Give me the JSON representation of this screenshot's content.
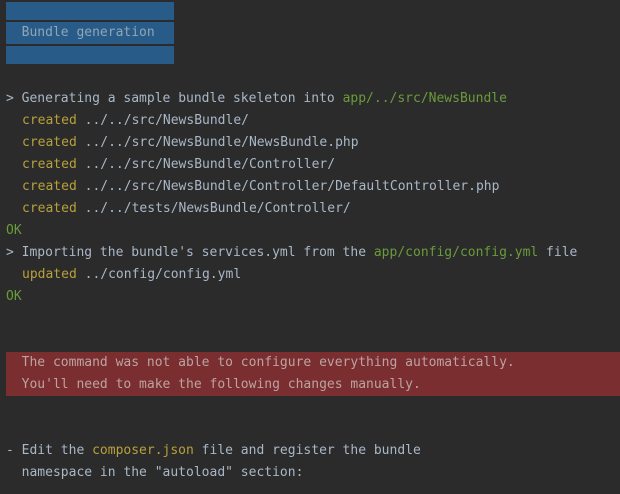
{
  "banner": {
    "title": "  Bundle generation"
  },
  "generate": {
    "prompt": "> ",
    "text": "Generating a sample bundle skeleton into ",
    "path": "app/../src/NewsBundle",
    "created": [
      {
        "label": "created",
        "path": " ../../src/NewsBundle/"
      },
      {
        "label": "created",
        "path": " ../../src/NewsBundle/NewsBundle.php"
      },
      {
        "label": "created",
        "path": " ../../src/NewsBundle/Controller/"
      },
      {
        "label": "created",
        "path": " ../../src/NewsBundle/Controller/DefaultController.php"
      },
      {
        "label": "created",
        "path": " ../../tests/NewsBundle/Controller/"
      }
    ],
    "ok": "OK"
  },
  "import": {
    "prompt": "> ",
    "text1": "Importing the bundle's services.yml from the ",
    "path": "app/config/config.yml",
    "text2": " file",
    "updated_label": "updated",
    "updated_path": " ../config/config.yml",
    "ok": "OK"
  },
  "error": {
    "line1": "  The command was not able to configure everything automatically.",
    "line2": "  You'll need to make the following changes manually."
  },
  "instructions": {
    "line1_prefix": "- Edit the ",
    "line1_file": "composer.json",
    "line1_suffix": " file and register the bundle",
    "line2": "  namespace in the \"autoload\" section:"
  }
}
